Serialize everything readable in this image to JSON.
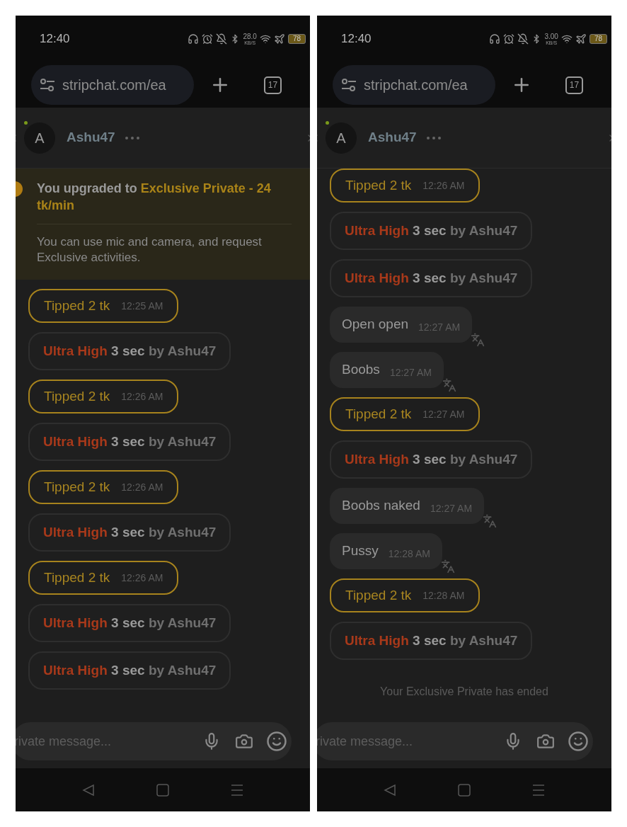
{
  "panels": [
    {
      "status": {
        "time": "12:40",
        "speed": "28.0",
        "speed_unit": "KB/S",
        "battery": "78"
      },
      "browser": {
        "url": "stripchat.com/ea",
        "tab_count": "17"
      },
      "chat": {
        "avatar_letter": "A",
        "name": "Ashu47",
        "online": true
      },
      "messages": [
        {
          "kind": "notice",
          "prefix": "You upgraded to",
          "highlight": "Exclusive Private - 24 tk/min",
          "detail": "You can use mic and camera, and request Exclusive activities."
        },
        {
          "kind": "tip",
          "text": "Tipped 2 tk",
          "time": "12:25 AM"
        },
        {
          "kind": "effect",
          "level": "Ultra High",
          "duration": "3 sec",
          "by": "by Ashu47"
        },
        {
          "kind": "tip",
          "text": "Tipped 2 tk",
          "time": "12:26 AM"
        },
        {
          "kind": "effect",
          "level": "Ultra High",
          "duration": "3 sec",
          "by": "by Ashu47"
        },
        {
          "kind": "tip",
          "text": "Tipped 2 tk",
          "time": "12:26 AM"
        },
        {
          "kind": "effect",
          "level": "Ultra High",
          "duration": "3 sec",
          "by": "by Ashu47"
        },
        {
          "kind": "tip",
          "text": "Tipped 2 tk",
          "time": "12:26 AM"
        },
        {
          "kind": "effect",
          "level": "Ultra High",
          "duration": "3 sec",
          "by": "by Ashu47"
        },
        {
          "kind": "effect",
          "level": "Ultra High",
          "duration": "3 sec",
          "by": "by Ashu47"
        }
      ],
      "input": {
        "placeholder": "rivate message..."
      }
    },
    {
      "status": {
        "time": "12:40",
        "speed": "3.00",
        "speed_unit": "KB/S",
        "battery": "78"
      },
      "browser": {
        "url": "stripchat.com/ea",
        "tab_count": "17"
      },
      "chat": {
        "avatar_letter": "A",
        "name": "Ashu47",
        "online": true
      },
      "messages": [
        {
          "kind": "tip",
          "text": "Tipped 2 tk",
          "time": "12:26 AM"
        },
        {
          "kind": "effect",
          "level": "Ultra High",
          "duration": "3 sec",
          "by": "by Ashu47"
        },
        {
          "kind": "effect",
          "level": "Ultra High",
          "duration": "3 sec",
          "by": "by Ashu47"
        },
        {
          "kind": "text",
          "text": "Open open",
          "time": "12:27 AM"
        },
        {
          "kind": "text",
          "text": "Boobs",
          "time": "12:27 AM"
        },
        {
          "kind": "tip",
          "text": "Tipped 2 tk",
          "time": "12:27 AM"
        },
        {
          "kind": "effect",
          "level": "Ultra High",
          "duration": "3 sec",
          "by": "by Ashu47"
        },
        {
          "kind": "text",
          "text": "Boobs naked",
          "time": "12:27 AM"
        },
        {
          "kind": "text",
          "text": "Pussy",
          "time": "12:28 AM"
        },
        {
          "kind": "tip",
          "text": "Tipped 2 tk",
          "time": "12:28 AM"
        },
        {
          "kind": "effect",
          "level": "Ultra High",
          "duration": "3 sec",
          "by": "by Ashu47"
        },
        {
          "kind": "system",
          "text": "Your Exclusive Private has ended"
        }
      ],
      "input": {
        "placeholder": "rivate message..."
      }
    }
  ]
}
